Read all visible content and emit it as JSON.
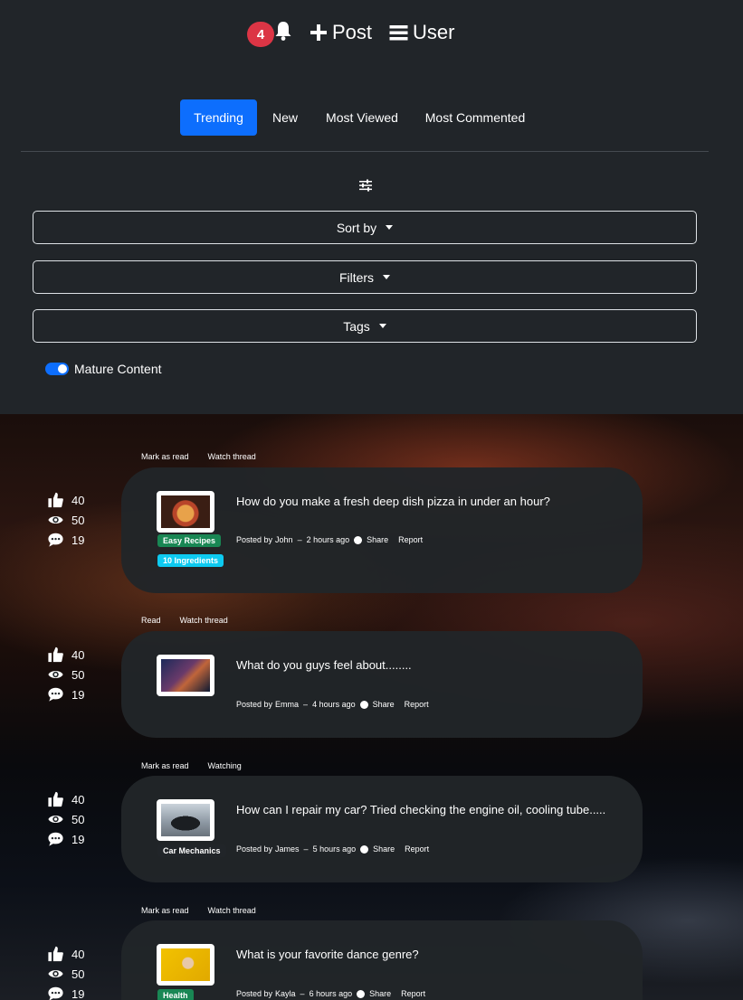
{
  "nav": {
    "notification_count": "4",
    "post_label": "Post",
    "user_label": "User"
  },
  "tabs": [
    {
      "label": "Trending",
      "active": true
    },
    {
      "label": "New"
    },
    {
      "label": "Most Viewed"
    },
    {
      "label": "Most Commented"
    }
  ],
  "controls": {
    "sort_label": "Sort by",
    "filters_label": "Filters",
    "tags_label": "Tags",
    "mature_label": "Mature Content",
    "mature_enabled": true
  },
  "posts": [
    {
      "likes": "40",
      "views": "50",
      "comments": "19",
      "action_read": "Mark as read",
      "action_watch": "Watch thread",
      "title": "How do you make a fresh deep dish pizza in under an hour?",
      "posted_by": "Posted by",
      "author": "John",
      "time": "2 hours ago",
      "share": "Share",
      "report": "Report",
      "tags": [
        "Easy Recipes",
        "10 Ingredients"
      ]
    },
    {
      "likes": "40",
      "views": "50",
      "comments": "19",
      "action_read": "Read",
      "action_watch": "Watch thread",
      "title": "What do you guys feel about........",
      "posted_by": "Posted by",
      "author": "Emma",
      "time": "4 hours ago",
      "share": "Share",
      "report": "Report",
      "tags": []
    },
    {
      "likes": "40",
      "views": "50",
      "comments": "19",
      "action_read": "Mark as read",
      "action_watch": "Watching",
      "title": "How can I repair my car? Tried checking the engine oil, cooling tube.....",
      "posted_by": "Posted by",
      "author": "James",
      "time": "5 hours ago",
      "share": "Share",
      "report": "Report",
      "tags": [
        "Car Mechanics"
      ]
    },
    {
      "likes": "40",
      "views": "50",
      "comments": "19",
      "action_read": "Mark as read",
      "action_watch": "Watch thread",
      "title": "What is your favorite dance genre?",
      "posted_by": "Posted by",
      "author": "Kayla",
      "time": "6 hours ago",
      "share": "Share",
      "report": "Report",
      "tags": [
        "Health"
      ]
    }
  ],
  "colors": {
    "primary": "#0d6efd",
    "danger": "#dc3545",
    "tag_green": "#198754",
    "tag_cyan": "#0dcaf0",
    "background": "#212529"
  }
}
